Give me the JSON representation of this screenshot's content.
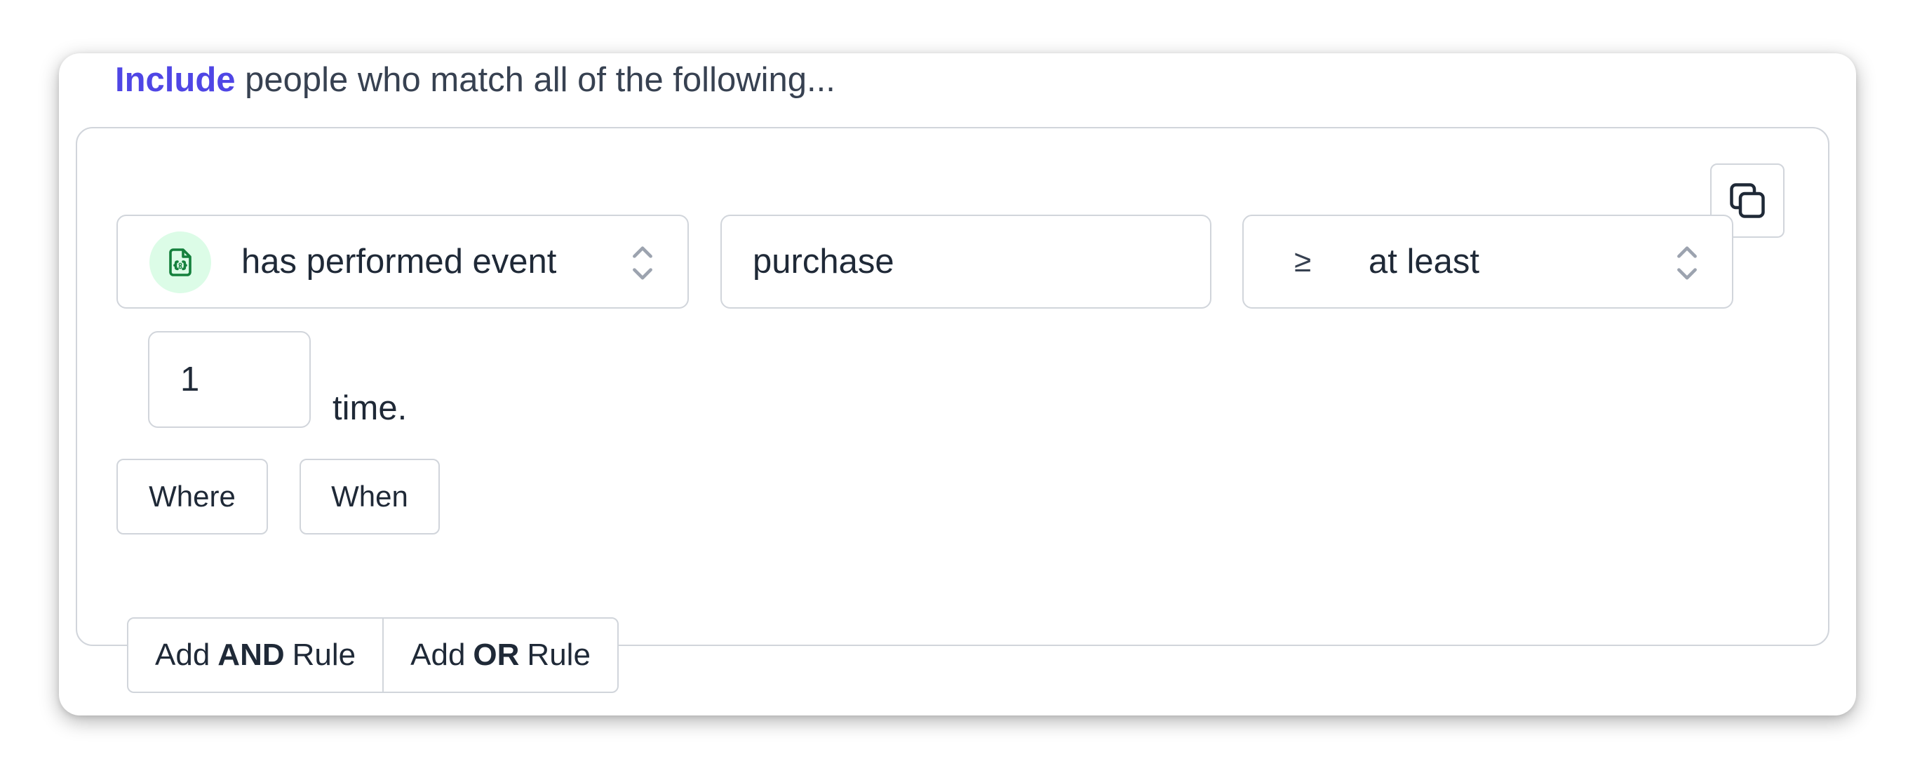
{
  "header": {
    "include": "Include",
    "text": "people who match all of the following..."
  },
  "rule": {
    "condition": "has performed event",
    "event_name": "purchase",
    "operator_symbol": "≥",
    "operator_label": "at least",
    "count": "1",
    "count_suffix": "time."
  },
  "filters": {
    "where": "Where",
    "when": "When"
  },
  "add_rule": {
    "and": {
      "prefix": "Add",
      "keyword": "AND",
      "suffix": "Rule"
    },
    "or": {
      "prefix": "Add",
      "keyword": "OR",
      "suffix": "Rule"
    }
  },
  "icons": {
    "copy": "copy-icon",
    "event": "code-file-icon",
    "select": "chevron-up-down-icon"
  },
  "colors": {
    "accent": "#4f46e5",
    "event_icon_bg": "#dcfce7",
    "event_icon_fg": "#15803d",
    "border": "#d1d5db"
  }
}
